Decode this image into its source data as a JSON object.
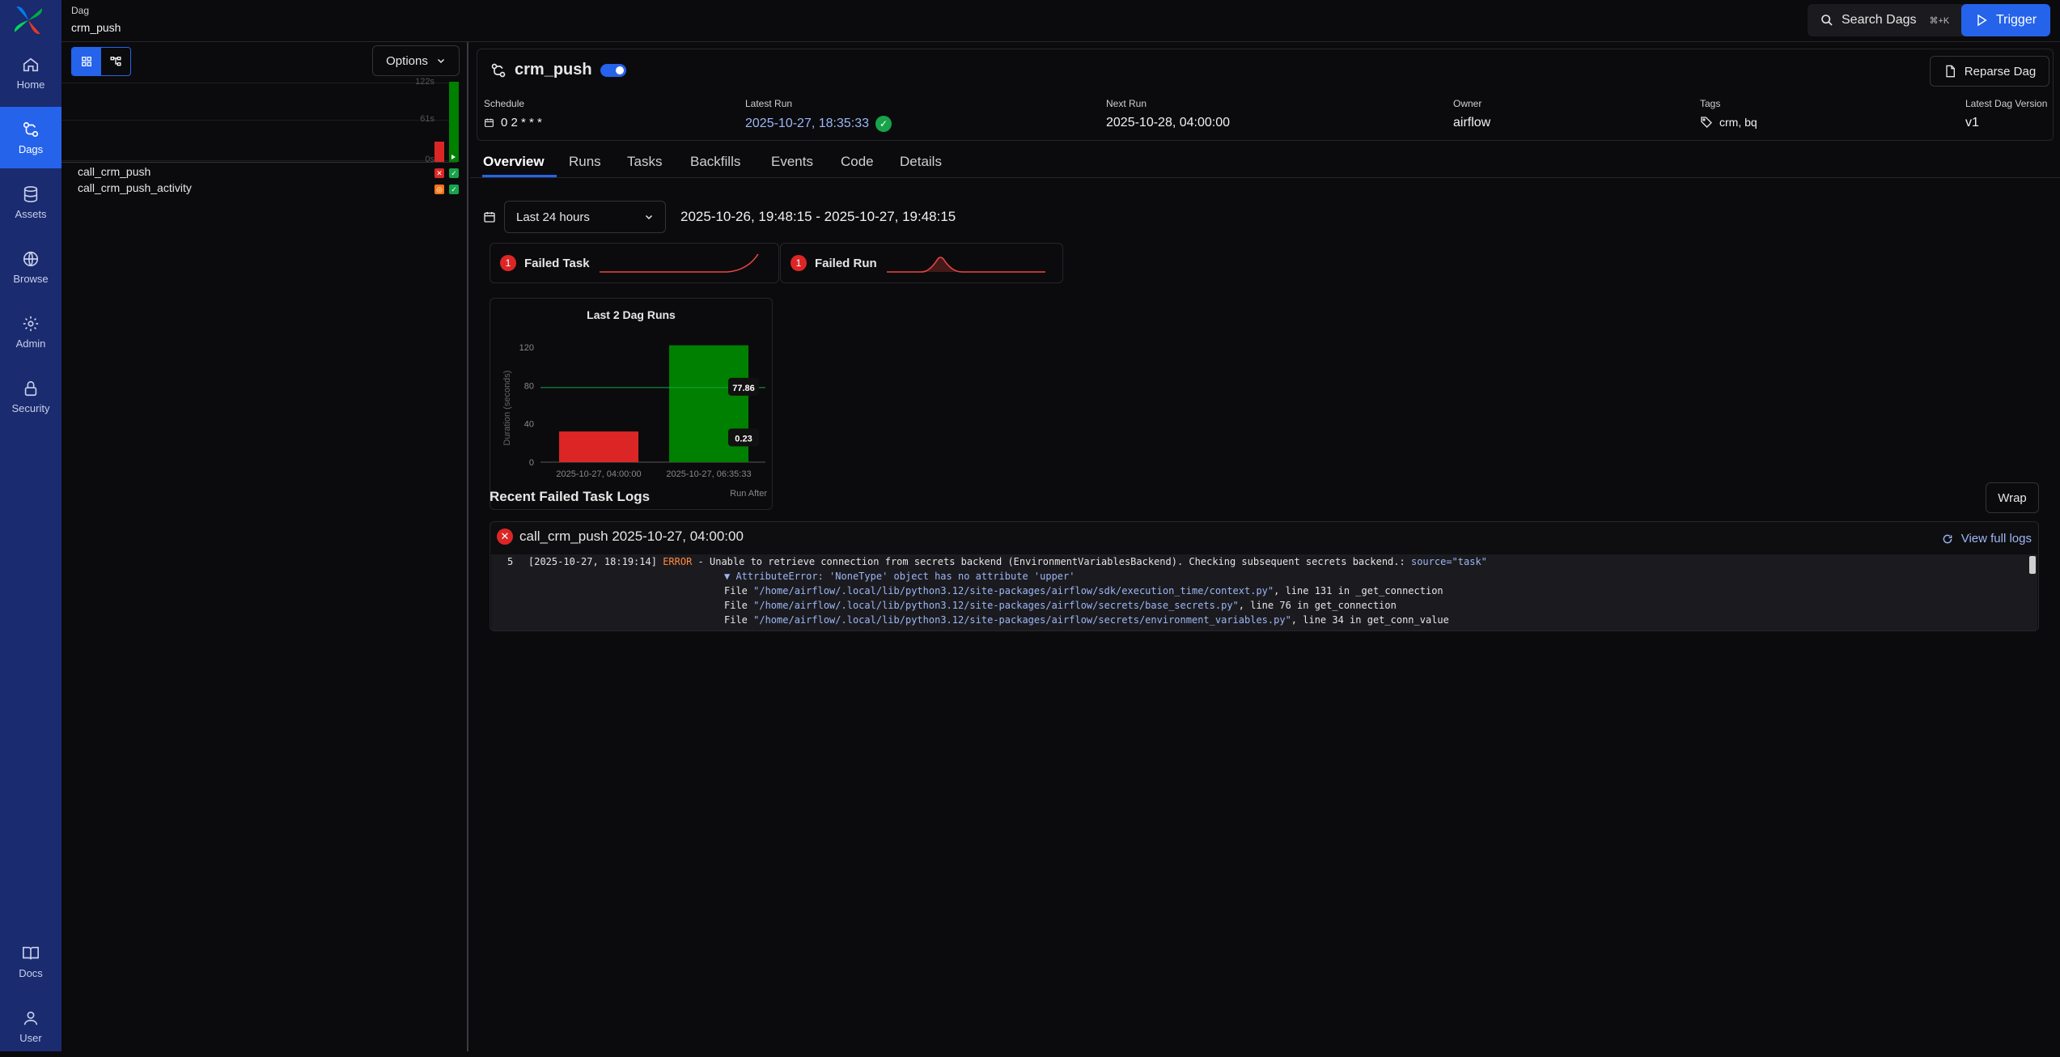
{
  "nav": {
    "items": [
      {
        "label": "Home",
        "icon": "home-icon"
      },
      {
        "label": "Dags",
        "icon": "dags-icon"
      },
      {
        "label": "Assets",
        "icon": "database-icon"
      },
      {
        "label": "Browse",
        "icon": "globe-icon"
      },
      {
        "label": "Admin",
        "icon": "gear-icon"
      },
      {
        "label": "Security",
        "icon": "lock-icon"
      },
      {
        "label": "Docs",
        "icon": "book-icon"
      },
      {
        "label": "User",
        "icon": "user-icon"
      }
    ]
  },
  "breadcrumb": {
    "section": "Dag",
    "current": "crm_push"
  },
  "search": {
    "label": "Search Dags",
    "shortcut": "⌘+K"
  },
  "trigger": {
    "label": "Trigger"
  },
  "left": {
    "options_label": "Options",
    "axis": [
      "122s",
      "61s",
      "0s"
    ],
    "tasks": [
      {
        "name": "call_crm_push",
        "states": [
          "failed",
          "success"
        ]
      },
      {
        "name": "call_crm_push_activity",
        "states": [
          "upstream_failed",
          "success"
        ]
      }
    ]
  },
  "dag": {
    "title": "crm_push",
    "reparse_label": "Reparse Dag",
    "schedule_label": "Schedule",
    "schedule": "0 2 * * *",
    "latest_run_label": "Latest Run",
    "latest_run": "2025-10-27, 18:35:33",
    "next_run_label": "Next Run",
    "next_run": "2025-10-28, 04:00:00",
    "owner_label": "Owner",
    "owner": "airflow",
    "tags_label": "Tags",
    "tags": "crm, bq",
    "version_label": "Latest Dag Version",
    "version": "v1"
  },
  "tabs": [
    "Overview",
    "Runs",
    "Tasks",
    "Backfills",
    "Events",
    "Code",
    "Details"
  ],
  "range": {
    "select": "Last 24 hours",
    "text": "2025-10-26, 19:48:15 - 2025-10-27, 19:48:15"
  },
  "stats": [
    {
      "count": "1",
      "label": "Failed Task"
    },
    {
      "count": "1",
      "label": "Failed Run"
    }
  ],
  "chart_data": {
    "type": "bar",
    "title": "Last 2 Dag Runs",
    "xlabel": "Run After",
    "ylabel": "Duration (seconds)",
    "categories": [
      "2025-10-27, 04:00:00",
      "2025-10-27, 06:35:33"
    ],
    "values": [
      32,
      122
    ],
    "colors": [
      "#dc2626",
      "#008000"
    ],
    "ylim": [
      0,
      120
    ],
    "yticks": [
      0,
      40,
      80,
      120
    ],
    "reference_line": 77.86,
    "annotations": [
      "77.86",
      "0.23"
    ]
  },
  "logs": {
    "section_title": "Recent Failed Task Logs",
    "wrap_label": "Wrap",
    "entry_title": "call_crm_push 2025-10-27, 04:00:00",
    "full_logs_label": "View full logs",
    "line_no": "5",
    "timestamp": "[2025-10-27, 18:19:14]",
    "level": "ERROR",
    "message": "- Unable to retrieve connection from secrets backend (EnvironmentVariablesBackend). Checking subsequent secrets backend.:",
    "source": "source=\"task\"",
    "exception": "▼ AttributeError: 'NoneType' object has no attribute 'upper'",
    "trace": [
      {
        "file": "\"/home/airflow/.local/lib/python3.12/site-packages/airflow/sdk/execution_time/context.py\"",
        "rest": ", line 131 in _get_connection"
      },
      {
        "file": "\"/home/airflow/.local/lib/python3.12/site-packages/airflow/secrets/base_secrets.py\"",
        "rest": ", line 76 in get_connection"
      },
      {
        "file": "\"/home/airflow/.local/lib/python3.12/site-packages/airflow/secrets/environment_variables.py\"",
        "rest": ", line 34 in get_conn_value"
      }
    ]
  }
}
